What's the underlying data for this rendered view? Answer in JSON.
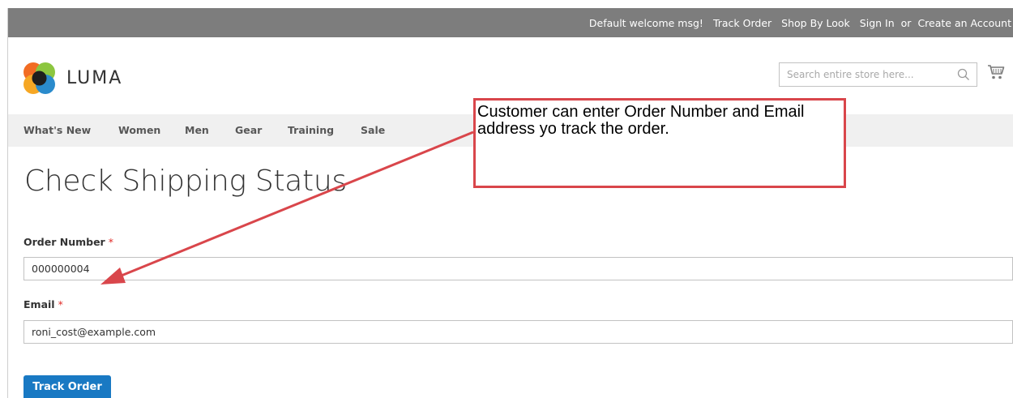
{
  "topbar": {
    "welcome": "Default welcome msg!",
    "track_order": "Track Order",
    "shop_by_look": "Shop By Look",
    "sign_in": "Sign In",
    "or": "or",
    "create_account": "Create an Account"
  },
  "header": {
    "logo_text": "LUMA",
    "search_placeholder": "Search entire store here..."
  },
  "nav": {
    "items": [
      "What's New",
      "Women",
      "Men",
      "Gear",
      "Training",
      "Sale"
    ]
  },
  "main": {
    "title": "Check Shipping Status",
    "order_number_label": "Order Number",
    "order_number_value": "000000004",
    "email_label": "Email",
    "email_value": "roni_cost@example.com",
    "required_mark": "*",
    "submit_label": "Track Order"
  },
  "annotation": {
    "text": "Customer can enter Order Number and Email address yo track the order."
  },
  "colors": {
    "topbar_bg": "#7d7d7d",
    "nav_bg": "#f0f0f0",
    "button_bg": "#1979c3",
    "required": "#e02b27",
    "annotation_border": "#d9464b"
  },
  "icons": {
    "logo": "luma-logo-icon",
    "search": "search-icon",
    "cart": "cart-icon",
    "arrow": "arrow-icon"
  }
}
